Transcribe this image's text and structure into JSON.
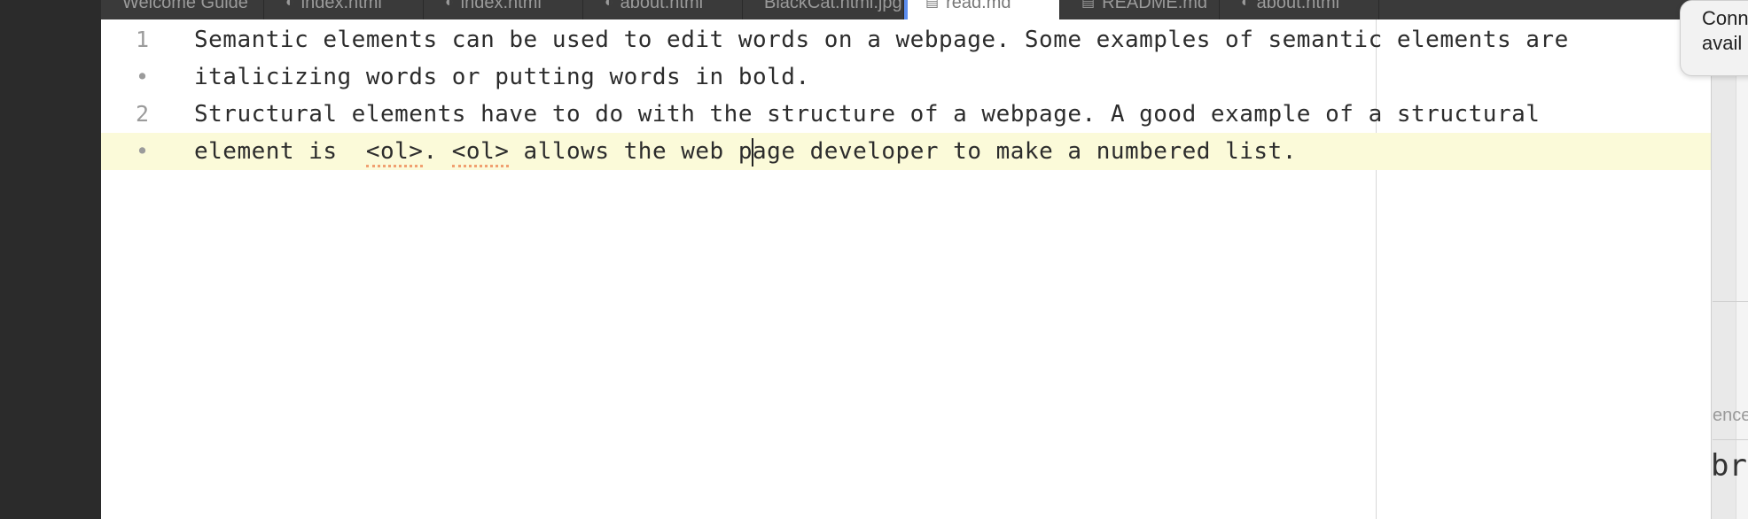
{
  "tabs": [
    {
      "label": "Welcome Guide",
      "icon": "",
      "active": false
    },
    {
      "label": "index.html",
      "icon": "github-icon",
      "active": false
    },
    {
      "label": "index.html",
      "icon": "github-icon",
      "active": false
    },
    {
      "label": "about.html",
      "icon": "github-icon",
      "active": false
    },
    {
      "label": "BlackCat.html.jpg",
      "icon": "",
      "active": false
    },
    {
      "label": "read.md",
      "icon": "file-icon",
      "active": true
    },
    {
      "label": "README.md",
      "icon": "file-icon",
      "active": false
    },
    {
      "label": "about.html",
      "icon": "github-icon",
      "active": false
    }
  ],
  "editor": {
    "lines": [
      {
        "gutter": "1",
        "text": "Semantic elements can be used to edit words on a webpage. Some examples of semantic elements are"
      },
      {
        "gutter": "•",
        "text": "italicizing words or putting words in bold."
      },
      {
        "gutter": "2",
        "text": "Structural elements have to do with the structure of a webpage. A good example of a structural"
      },
      {
        "gutter": "•",
        "pre": "element is  ",
        "tag1": "<ol>",
        "mid": ". ",
        "tag2": "<ol>",
        "post_a": " allows the web p",
        "post_b": "age developer to make a numbered list."
      }
    ]
  },
  "right_panel": {
    "notification_text": "Conn avail",
    "hint_text": "ence",
    "tag_text": "br>"
  }
}
